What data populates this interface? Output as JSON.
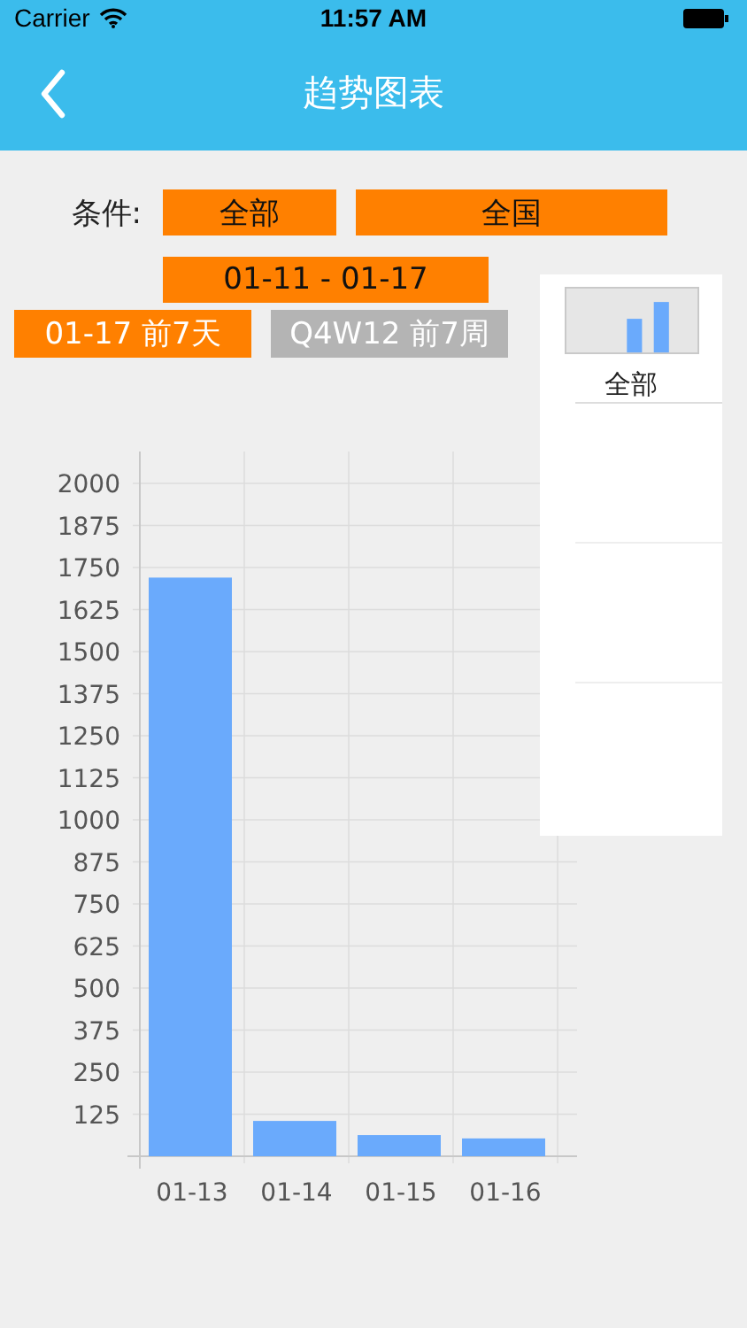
{
  "status_bar": {
    "carrier": "Carrier",
    "time": "11:57 AM"
  },
  "nav": {
    "title": "趋势图表"
  },
  "filters": {
    "label": "条件:",
    "region": "全部",
    "area": "全国",
    "date_range": "01-11 - 01-17",
    "periods": [
      {
        "label": "01-17 前7天",
        "selected": true
      },
      {
        "label": "Q4W12 前7周",
        "selected": false
      }
    ]
  },
  "chart": {
    "chart_data": {
      "type": "bar",
      "categories": [
        "01-13",
        "01-14",
        "01-15",
        "01-16"
      ],
      "series": [
        {
          "name": "全部",
          "color": "#6aaafc",
          "values": [
            1720,
            105,
            63,
            53
          ]
        }
      ],
      "ylim": [
        0,
        2000
      ],
      "grid": true,
      "yticks": [
        125,
        250,
        375,
        500,
        625,
        750,
        875,
        1000,
        1125,
        1250,
        1375,
        1500,
        1625,
        1750,
        1875,
        2000
      ]
    }
  }
}
